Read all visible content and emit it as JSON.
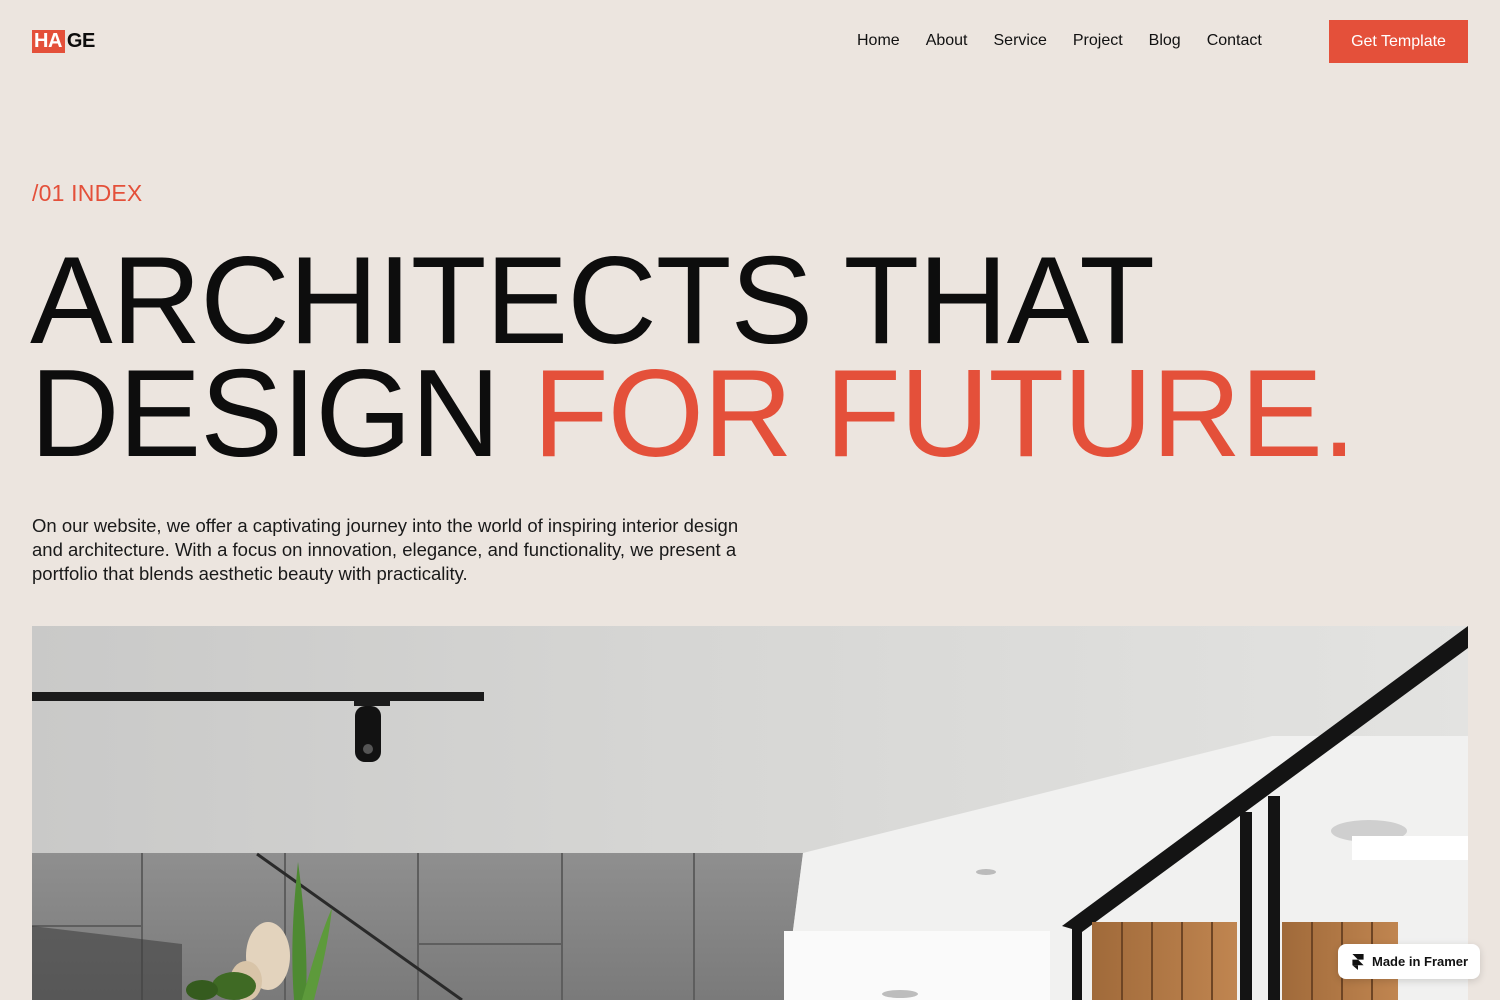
{
  "logo": {
    "part_a": "HA",
    "part_b": "GE"
  },
  "nav": {
    "items": [
      "Home",
      "About",
      "Service",
      "Project",
      "Blog",
      "Contact"
    ],
    "cta_label": "Get Template"
  },
  "hero": {
    "eyebrow": "/01 INDEX",
    "headline_line1": "ARCHITECTS THAT",
    "headline_line2_a": "DESIGN ",
    "headline_line2_b": "FOR FUTURE.",
    "intro": "On our website, we offer a captivating journey into the world of inspiring interior design and architecture. With a focus on innovation, elegance, and functionality, we present a portfolio that blends aesthetic beauty with practicality."
  },
  "badge": {
    "label": "Made in Framer",
    "icon": "framer-icon"
  },
  "colors": {
    "accent": "#e4503a",
    "background": "#ece5df",
    "text": "#0d0d0d"
  }
}
